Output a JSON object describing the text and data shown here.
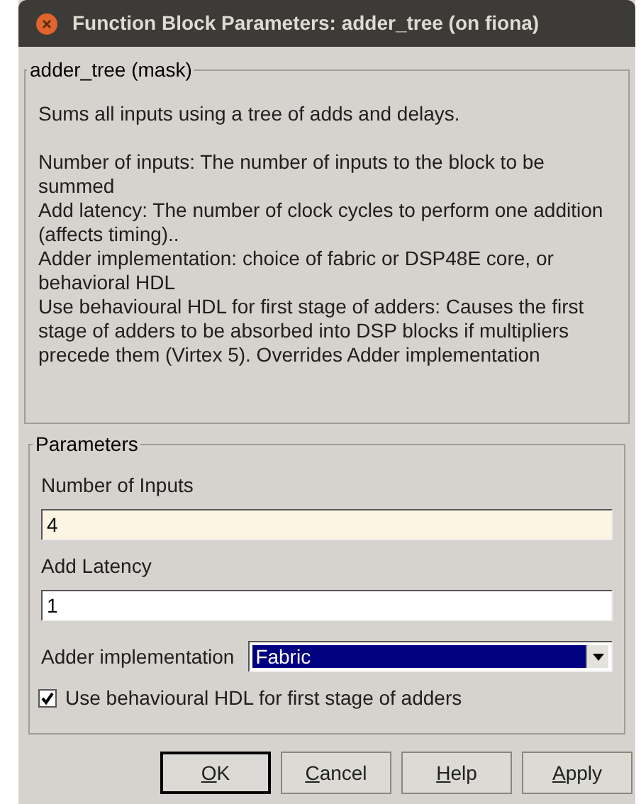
{
  "window": {
    "title": "Function Block Parameters: adder_tree (on fiona)"
  },
  "description": {
    "title": "adder_tree (mask)",
    "paragraphs": [
      "Sums all inputs using a tree of adds and delays.",
      "Number of inputs: The number of inputs to the block to be summed",
      "Add latency: The number of clock cycles to perform one addition (affects timing)..",
      "Adder implementation: choice of fabric or DSP48E core, or behavioral HDL",
      "Use behavioural HDL for first stage of adders: Causes the first stage of adders to be absorbed into DSP blocks if multipliers precede them (Virtex 5). Overrides Adder implementation"
    ]
  },
  "parameters": {
    "title": "Parameters",
    "items": [
      {
        "kind": "edit",
        "label": "Number of Inputs",
        "value": "4",
        "focused": true
      },
      {
        "kind": "edit",
        "label": "Add Latency",
        "value": "1",
        "focused": false
      },
      {
        "kind": "popup",
        "label": "Adder implementation",
        "value": "Fabric",
        "selected": true
      },
      {
        "kind": "checkbox",
        "label": "Use behavioural HDL for first stage of adders",
        "checked": true
      }
    ]
  },
  "buttons": [
    {
      "label": "OK",
      "default": true,
      "underline_first": true
    },
    {
      "label": "Cancel",
      "default": false,
      "underline_first": true
    },
    {
      "label": "Help",
      "default": false,
      "underline_first": true
    },
    {
      "label": "Apply",
      "default": false,
      "underline_first": true
    }
  ]
}
